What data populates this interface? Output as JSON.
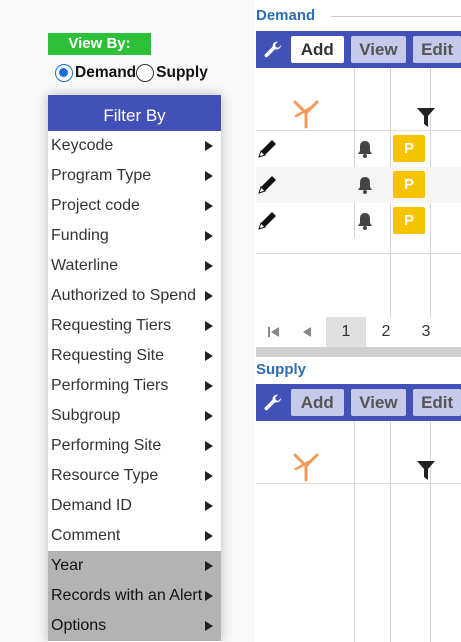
{
  "view_by": {
    "label": "View By:",
    "options": [
      {
        "label": "Demand",
        "selected": true
      },
      {
        "label": "Supply",
        "selected": false
      }
    ]
  },
  "filter": {
    "title": "Filter By",
    "items": [
      {
        "label": "Keycode"
      },
      {
        "label": "Program Type"
      },
      {
        "label": "Project code"
      },
      {
        "label": "Funding"
      },
      {
        "label": "Waterline"
      },
      {
        "label": "Authorized to Spend"
      },
      {
        "label": "Requesting Tiers"
      },
      {
        "label": "Requesting Site"
      },
      {
        "label": "Performing Tiers"
      },
      {
        "label": "Subgroup"
      },
      {
        "label": "Performing Site"
      },
      {
        "label": "Resource Type"
      },
      {
        "label": "Demand ID"
      },
      {
        "label": "Comment"
      },
      {
        "label": "Year",
        "highlighted": true
      },
      {
        "label": "Records with an Alert",
        "highlighted": true
      },
      {
        "label": "Options",
        "highlighted": true
      }
    ]
  },
  "demand": {
    "title": "Demand",
    "toolbar": {
      "add": "Add",
      "view": "View",
      "edit": "Edit"
    },
    "rows": [
      {
        "badge": "P"
      },
      {
        "badge": "P"
      },
      {
        "badge": "P"
      }
    ],
    "pager": {
      "pages": [
        "1",
        "2",
        "3"
      ],
      "current": "1"
    }
  },
  "supply": {
    "title": "Supply",
    "toolbar": {
      "add": "Add",
      "view": "View",
      "edit": "Edit"
    }
  },
  "colors": {
    "toolbar": "#4151b8",
    "view_by_badge": "#2fc03a",
    "section_title": "#2f6db1",
    "badge": "#f7c200",
    "alert_filter_icon": "#f39a5a"
  },
  "icons": {
    "wrench": "wrench-icon",
    "pencil": "pencil-edit-icon",
    "bell": "bell-icon",
    "filter": "filter-icon",
    "clear_filter": "clear-filter-icon",
    "first_page": "first-page-icon",
    "prev_page": "previous-page-icon",
    "submenu": "chevron-right-icon"
  }
}
